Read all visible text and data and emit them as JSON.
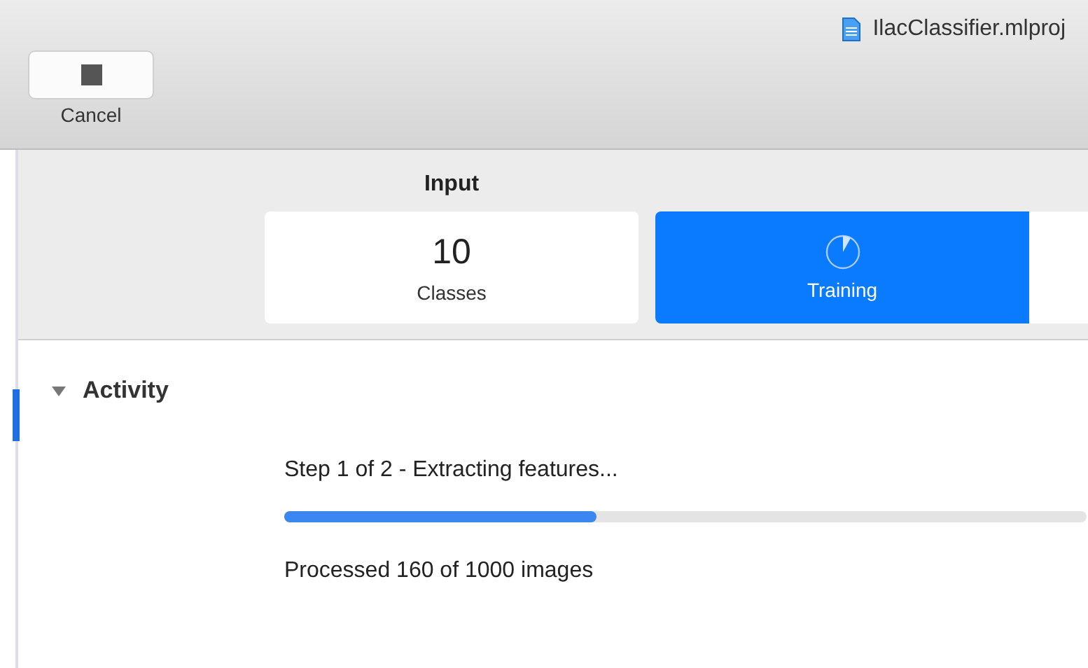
{
  "window": {
    "title": "IlacClassifier.mlproj"
  },
  "toolbar": {
    "cancel_button": {
      "label": "Cancel"
    }
  },
  "stages": [
    {
      "kind": "count",
      "header": "Input",
      "value": "10",
      "label": "Classes",
      "selected": false
    },
    {
      "kind": "progress",
      "label": "Training",
      "selected": true
    }
  ],
  "activity": {
    "title": "Activity",
    "expanded": true,
    "step": "Step 1 of 2 - Extracting features...",
    "level": 0.39,
    "status": "Processed 160 of 1000 images"
  }
}
